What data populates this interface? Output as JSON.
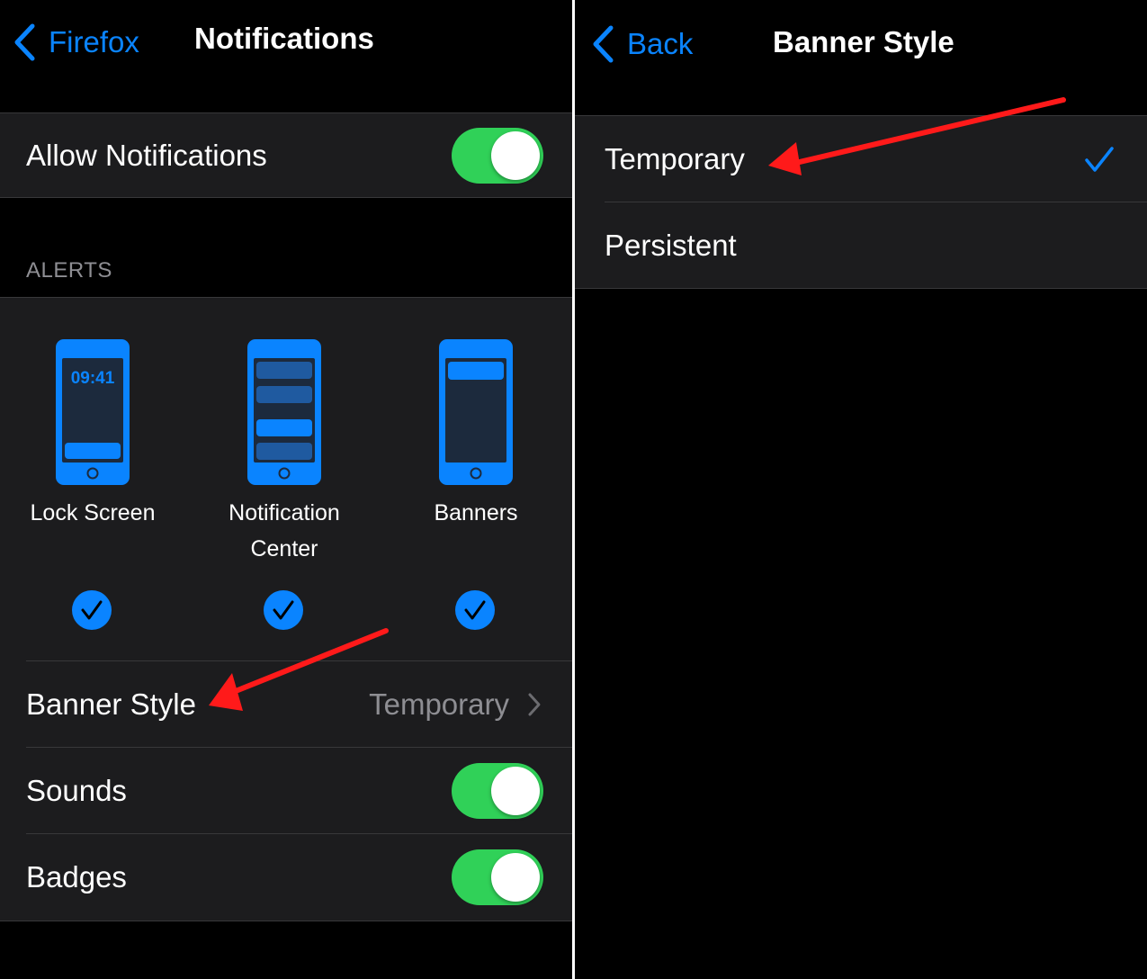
{
  "left": {
    "nav": {
      "back_label": "Firefox",
      "title": "Notifications"
    },
    "allow_notifications": {
      "label": "Allow Notifications",
      "on": true
    },
    "alerts": {
      "header": "ALERTS",
      "options": [
        {
          "line1": "Lock Screen",
          "line2": "",
          "time": "09:41",
          "checked": true
        },
        {
          "line1": "Notification",
          "line2": "Center",
          "checked": true
        },
        {
          "line1": "Banners",
          "line2": "",
          "checked": true
        }
      ]
    },
    "banner_style": {
      "label": "Banner Style",
      "value": "Temporary"
    },
    "sounds": {
      "label": "Sounds",
      "on": true
    },
    "badges": {
      "label": "Badges",
      "on": true
    }
  },
  "right": {
    "nav": {
      "back_label": "Back",
      "title": "Banner Style"
    },
    "options": [
      {
        "label": "Temporary",
        "selected": true
      },
      {
        "label": "Persistent",
        "selected": false
      }
    ]
  },
  "colors": {
    "accent": "#0a84ff",
    "toggle_on": "#30d158",
    "cell_bg": "#1c1c1e",
    "annotation_arrow": "#ff1a1a"
  }
}
